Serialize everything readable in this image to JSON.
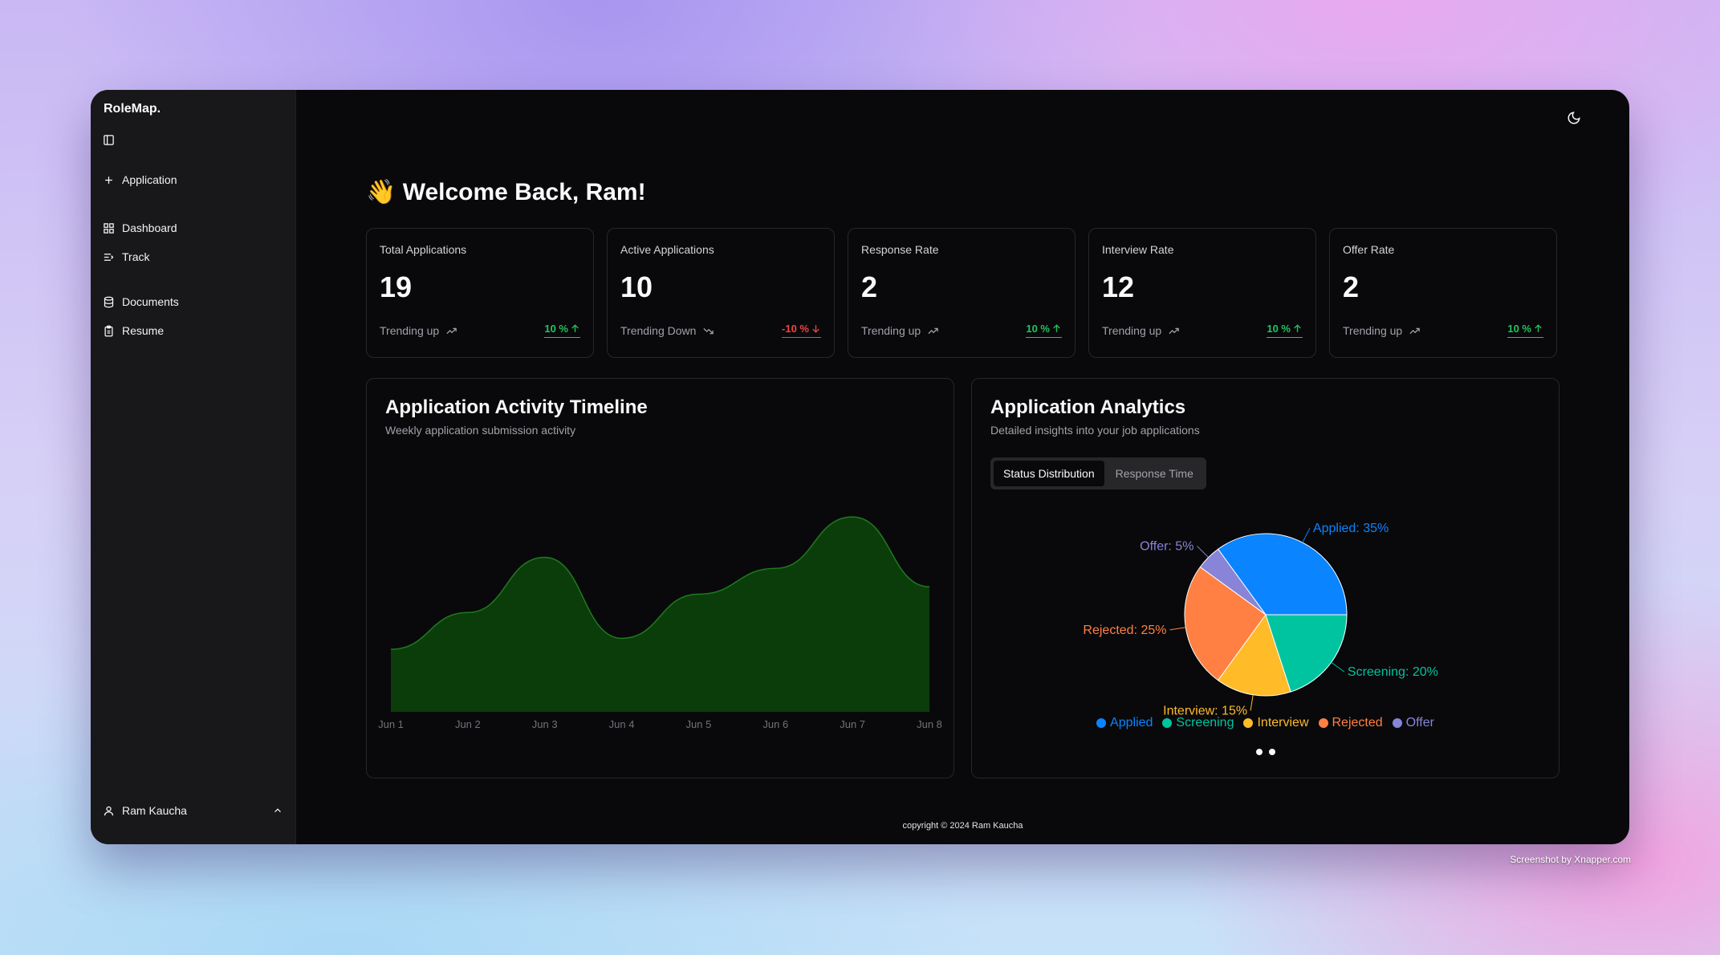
{
  "app": {
    "brand": "RoleMap."
  },
  "sidebar": {
    "new_item": "Application",
    "items": [
      {
        "label": "Dashboard",
        "icon": "grid-icon"
      },
      {
        "label": "Track",
        "icon": "list-icon"
      },
      {
        "label": "Documents",
        "icon": "database-icon"
      },
      {
        "label": "Resume",
        "icon": "clipboard-icon"
      }
    ],
    "user": "Ram Kaucha"
  },
  "header": {
    "welcome": "👋 Welcome Back, Ram!"
  },
  "stats": [
    {
      "label": "Total Applications",
      "value": "19",
      "trend": "Trending up",
      "change": "10 %",
      "direction": "up"
    },
    {
      "label": "Active Applications",
      "value": "10",
      "trend": "Trending Down",
      "change": "-10 %",
      "direction": "down"
    },
    {
      "label": "Response Rate",
      "value": "2",
      "trend": "Trending up",
      "change": "10 %",
      "direction": "up"
    },
    {
      "label": "Interview Rate",
      "value": "12",
      "trend": "Trending up",
      "change": "10 %",
      "direction": "up"
    },
    {
      "label": "Offer Rate",
      "value": "2",
      "trend": "Trending up",
      "change": "10 %",
      "direction": "up"
    }
  ],
  "timeline": {
    "title": "Application Activity Timeline",
    "subtitle": "Weekly application submission activity"
  },
  "analytics": {
    "title": "Application Analytics",
    "subtitle": "Detailed insights into your job applications",
    "tabs": [
      "Status Distribution",
      "Response Time"
    ]
  },
  "chart_data": [
    {
      "type": "area",
      "x": [
        "Jun 1",
        "Jun 2",
        "Jun 3",
        "Jun 4",
        "Jun 5",
        "Jun 6",
        "Jun 7",
        "Jun 8"
      ],
      "values": [
        3.4,
        5.4,
        8.4,
        4.0,
        6.4,
        7.8,
        10.6,
        6.8
      ],
      "ylim": [
        0,
        12
      ],
      "color": "#0b3d0b",
      "stroke": "#1f7a1f",
      "grid": false
    },
    {
      "type": "pie",
      "slices": [
        {
          "name": "Applied",
          "label": "Applied: 35%",
          "value": 35,
          "color": "#0a84ff"
        },
        {
          "name": "Offer",
          "label": "Offer: 5%",
          "value": 5,
          "color": "#8884d8"
        },
        {
          "name": "Rejected",
          "label": "Rejected: 25%",
          "value": 25,
          "color": "#ff8042"
        },
        {
          "name": "Interview",
          "label": "Interview: 15%",
          "value": 15,
          "color": "#ffbb28"
        },
        {
          "name": "Screening",
          "label": "Screening: 20%",
          "value": 20,
          "color": "#00c49f"
        }
      ],
      "legend_order": [
        "Applied",
        "Screening",
        "Interview",
        "Rejected",
        "Offer"
      ]
    }
  ],
  "footer": "copyright © 2024 Ram Kaucha",
  "credit": "Screenshot by Xnapper.com"
}
